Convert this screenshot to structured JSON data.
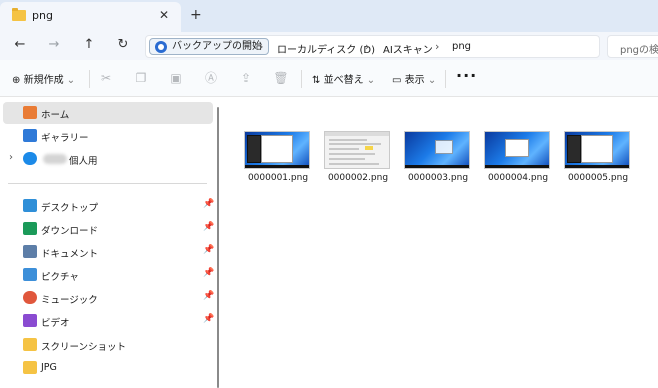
{
  "tab": {
    "title": "png",
    "close_glyph": "✕",
    "new_tab_glyph": "+"
  },
  "address": {
    "breadcrumbs": [
      "バックアップの開始",
      "ローカルディスク (D)",
      "AIスキャン",
      "png"
    ],
    "separator": "›",
    "search_placeholder": "pngの検索"
  },
  "toolbar": {
    "new_label": "新規作成",
    "sort_label": "並べ替え",
    "view_label": "表示",
    "more_glyph": "···",
    "icons": [
      "cut-icon",
      "copy-icon",
      "paste-icon",
      "rename-icon",
      "share-icon",
      "delete-icon"
    ]
  },
  "sidebar": {
    "items": [
      {
        "label": "ホーム",
        "icon": "home-icon",
        "color": "#e97b34",
        "selected": true
      },
      {
        "label": "ギャラリー",
        "icon": "gallery-icon",
        "color": "#2f7ad8"
      },
      {
        "label": "個人用",
        "icon": "onedrive-icon",
        "color": "#1c8ae8"
      }
    ],
    "quick": [
      {
        "label": "デスクトップ",
        "icon": "desktop-icon",
        "color": "#2f8fd8",
        "pinned": true
      },
      {
        "label": "ダウンロード",
        "icon": "download-icon",
        "color": "#1b9a59",
        "pinned": true
      },
      {
        "label": "ドキュメント",
        "icon": "documents-icon",
        "color": "#5d7ea8",
        "pinned": true
      },
      {
        "label": "ピクチャ",
        "icon": "pictures-icon",
        "color": "#3d8fd9",
        "pinned": true
      },
      {
        "label": "ミュージック",
        "icon": "music-icon",
        "color": "#e0573c",
        "pinned": true
      },
      {
        "label": "ビデオ",
        "icon": "videos-icon",
        "color": "#8a4bd1",
        "pinned": true
      },
      {
        "label": "スクリーンショット",
        "icon": "folder-icon",
        "color": "#f5c344"
      },
      {
        "label": "JPG",
        "icon": "folder-icon",
        "color": "#f5c344"
      }
    ],
    "pin_glyph": "📌"
  },
  "files": [
    {
      "name": "0000001.png",
      "kind": "desktop"
    },
    {
      "name": "0000002.png",
      "kind": "document"
    },
    {
      "name": "0000003.png",
      "kind": "desktop"
    },
    {
      "name": "0000004.png",
      "kind": "desktop"
    },
    {
      "name": "0000005.png",
      "kind": "desktop"
    }
  ]
}
